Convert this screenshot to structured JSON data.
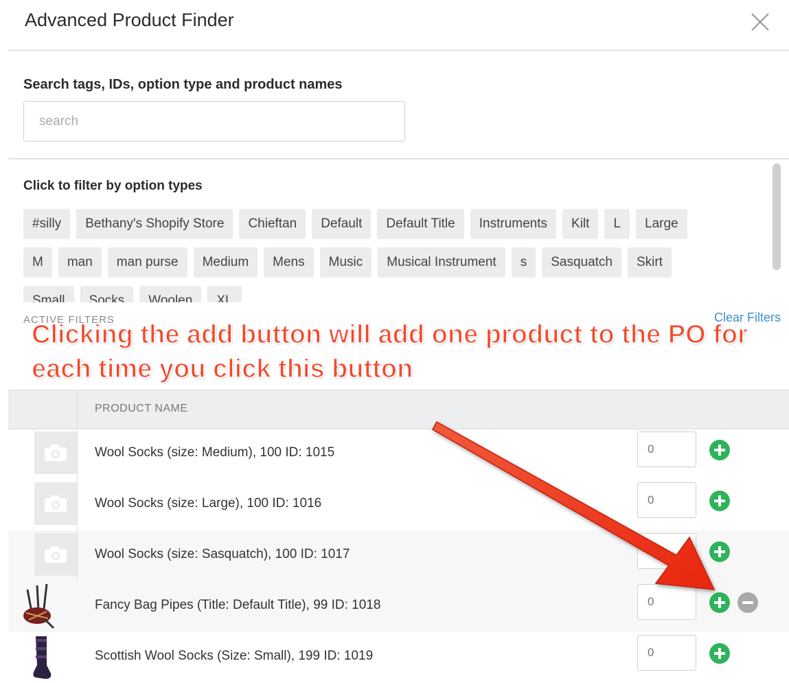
{
  "dialog": {
    "title": "Advanced Product Finder",
    "close_icon": "close-icon"
  },
  "search": {
    "label": "Search tags, IDs, option type and product names",
    "placeholder": "search",
    "value": ""
  },
  "filters": {
    "label": "Click to filter by option types",
    "tags": [
      "#silly",
      "Bethany's Shopify Store",
      "Chieftan",
      "Default",
      "Default Title",
      "Instruments",
      "Kilt",
      "L",
      "Large",
      "M",
      "man",
      "man purse",
      "Medium",
      "Mens",
      "Music",
      "Musical Instrument",
      "s",
      "Sasquatch",
      "Skirt",
      "Small",
      "Socks",
      "Woolen",
      "XL"
    ],
    "active_label": "ACTIVE FILTERS",
    "clear_label": "Clear Filters"
  },
  "annotation": {
    "text": "Clicking the add button will add one product to the PO for each time you click this button",
    "color": "#f24a2c"
  },
  "table": {
    "header": "PRODUCT NAME",
    "rows": [
      {
        "name": "Wool Socks (size: Medium), 100 ID: 1015",
        "qty": "0",
        "thumb": "camera-placeholder-icon"
      },
      {
        "name": "Wool Socks (size: Large), 100 ID: 1016",
        "qty": "0",
        "thumb": "camera-placeholder-icon"
      },
      {
        "name": "Wool Socks (size: Sasquatch), 100 ID: 1017",
        "qty": "0",
        "thumb": "camera-placeholder-icon"
      },
      {
        "name": "Fancy Bag Pipes (Title: Default Title), 99 ID: 1018",
        "qty": "0",
        "thumb": "bagpipes-image"
      },
      {
        "name": "Scottish Wool Socks (Size: Small), 199 ID: 1019",
        "qty": "0",
        "thumb": "sock-image"
      }
    ]
  },
  "colors": {
    "add": "#2fb25c",
    "remove": "#a9a9a9",
    "link": "#3a8fd0",
    "arrow": "#f23a1c"
  }
}
